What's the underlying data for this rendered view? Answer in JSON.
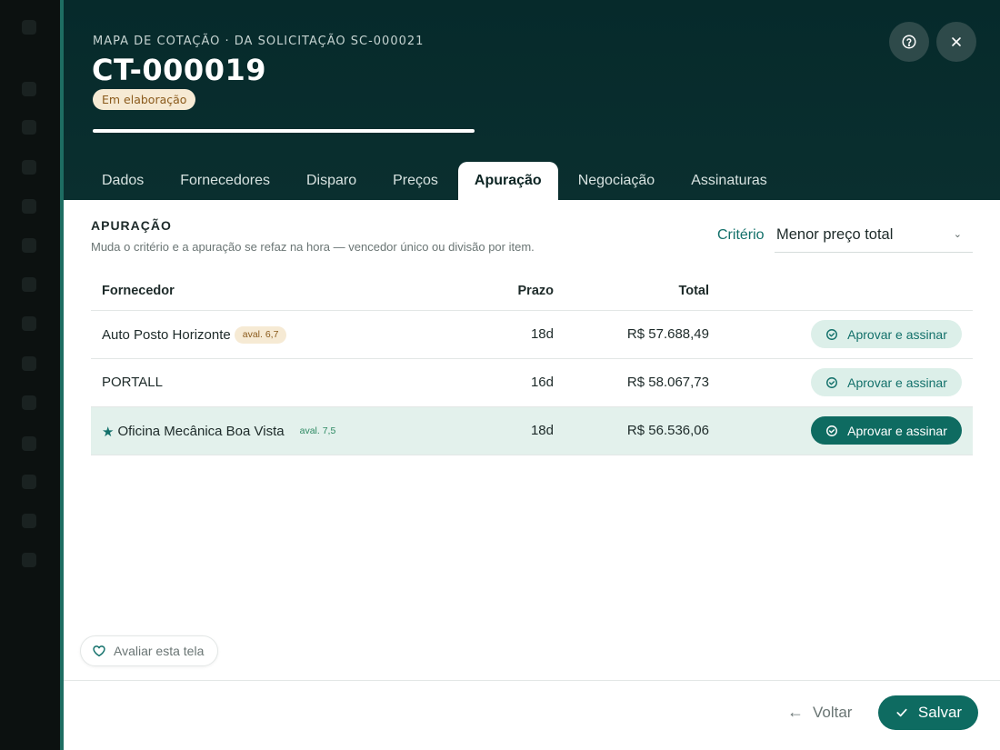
{
  "header": {
    "eyebrow": "MAPA DE COTAÇÃO · DA SOLICITAÇÃO SC-000021",
    "title": "CT-000019",
    "status": "Em elaboração",
    "progress_percent": 100,
    "help_icon": "help-circle-icon",
    "close_icon": "close-icon"
  },
  "tabs": [
    {
      "label": "Dados",
      "active": false
    },
    {
      "label": "Fornecedores",
      "active": false
    },
    {
      "label": "Disparo",
      "active": false
    },
    {
      "label": "Preços",
      "active": false
    },
    {
      "label": "Apuração",
      "active": true
    },
    {
      "label": "Negociação",
      "active": false
    },
    {
      "label": "Assinaturas",
      "active": false
    }
  ],
  "section": {
    "title": "APURAÇÃO",
    "subtitle": "Muda o critério e a apuração se refaz na hora — vencedor único ou divisão por item."
  },
  "criterio": {
    "label": "Critério",
    "value": "Menor preço total"
  },
  "table": {
    "headers": {
      "fornecedor": "Fornecedor",
      "prazo": "Prazo",
      "total": "Total"
    },
    "rows": [
      {
        "name": "Auto Posto Horizonte",
        "badge": "aval. 6,7",
        "prazo": "18d",
        "total": "R$ 57.688,49",
        "action": "Aprovar e assinar",
        "winner": false
      },
      {
        "name": "PORTALL",
        "badge": "",
        "prazo": "16d",
        "total": "R$ 58.067,73",
        "action": "Aprovar e assinar",
        "winner": false
      },
      {
        "name": "Oficina Mecânica Boa Vista",
        "badge": "aval. 7,5",
        "prazo": "18d",
        "total": "R$ 56.536,06",
        "action": "Aprovar e assinar",
        "winner": true,
        "star": "★"
      }
    ]
  },
  "rate_button": "Avaliar esta tela",
  "footer": {
    "back_label": "Voltar",
    "save_label": "Salvar"
  },
  "colors": {
    "brand": "#0e6b61",
    "header_bg": "#062a2b",
    "highlight_row": "#e3f1ec"
  }
}
